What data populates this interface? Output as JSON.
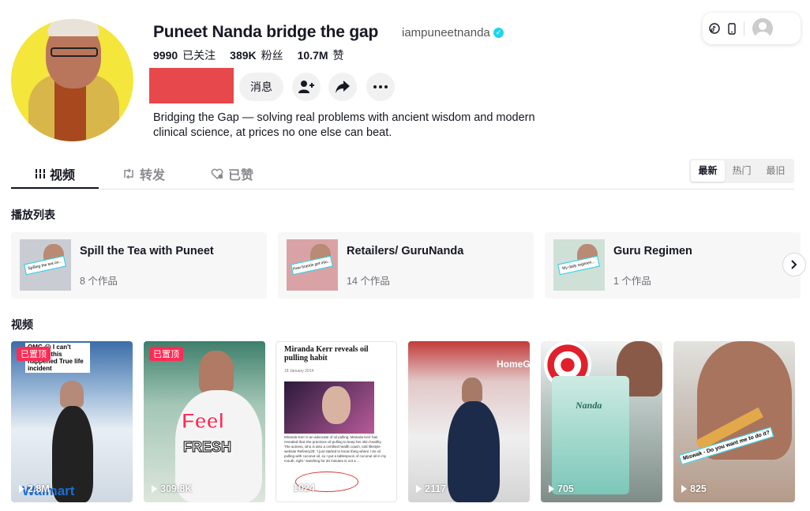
{
  "profile": {
    "name": "Puneet Nanda bridge the gap",
    "handle": "iampuneetnanda",
    "verified_icon": "✓",
    "stats": [
      {
        "value": "9990",
        "label": "已关注"
      },
      {
        "value": "389K",
        "label": "粉丝"
      },
      {
        "value": "10.7M",
        "label": "赞"
      }
    ],
    "message_label": "消息",
    "bio_line1": "Bridging the Gap — solving real problems with ancient wisdom and modern",
    "bio_line2": "clinical science, at prices no one else can beat."
  },
  "tabs": [
    {
      "label": "视频",
      "icon": "grid-icon",
      "active": true
    },
    {
      "label": "转发",
      "icon": "repost-icon",
      "active": false
    },
    {
      "label": "已赞",
      "icon": "heart-icon",
      "active": false
    }
  ],
  "sort": [
    "最新",
    "热门",
    "最旧"
  ],
  "playlists_title": "播放列表",
  "playlists": [
    {
      "title": "Spill the Tea with Puneet",
      "count": "8 个作品",
      "thumb_text": "Spilling the tea on..."
    },
    {
      "title": "Retailers/ GuruNanda",
      "count": "14 个作品",
      "thumb_text": "How brands get into..."
    },
    {
      "title": "Guru Regimen",
      "count": "1 个作品",
      "thumb_text": "My daily regimen..."
    }
  ],
  "videos_title": "视频",
  "videos": [
    {
      "views": "2.8M",
      "pinned": true,
      "pin_label": "已置顶",
      "overlay": "OMG 😱 I can't believe this happened True life incident",
      "brand": "Walmart"
    },
    {
      "views": "309.8K",
      "pinned": true,
      "pin_label": "已置顶",
      "overlay1": "Feel",
      "overlay2": "FRESH"
    },
    {
      "views": "1024",
      "pinned": false,
      "headline": "Miranda Kerr reveals oil pulling habit",
      "date": "18 January 2014",
      "article_text": "Miranda Kerr is an advocate of oil pulling. Miranda Kerr has revealed that she practices oil pulling to keep her skin healthy. The actress, who is also a certified health coach, told lifestyle website Refinery29: 'I just started to know thing where I do oil pulling with coconut oil, so I put a tablespoon of coconut oil in my mouth, right.' Swishing for 20 minutes is not a ..."
    },
    {
      "views": "2117",
      "pinned": false,
      "sign": "HomeG"
    },
    {
      "views": "705",
      "pinned": false,
      "brand": "Nanda"
    },
    {
      "views": "825",
      "pinned": false,
      "overlay": "Miswak - Do you want me to do it?"
    }
  ],
  "colors": {
    "accent": "#fe2c55",
    "verified": "#20d5ec",
    "follow_block": "#e6484c"
  }
}
